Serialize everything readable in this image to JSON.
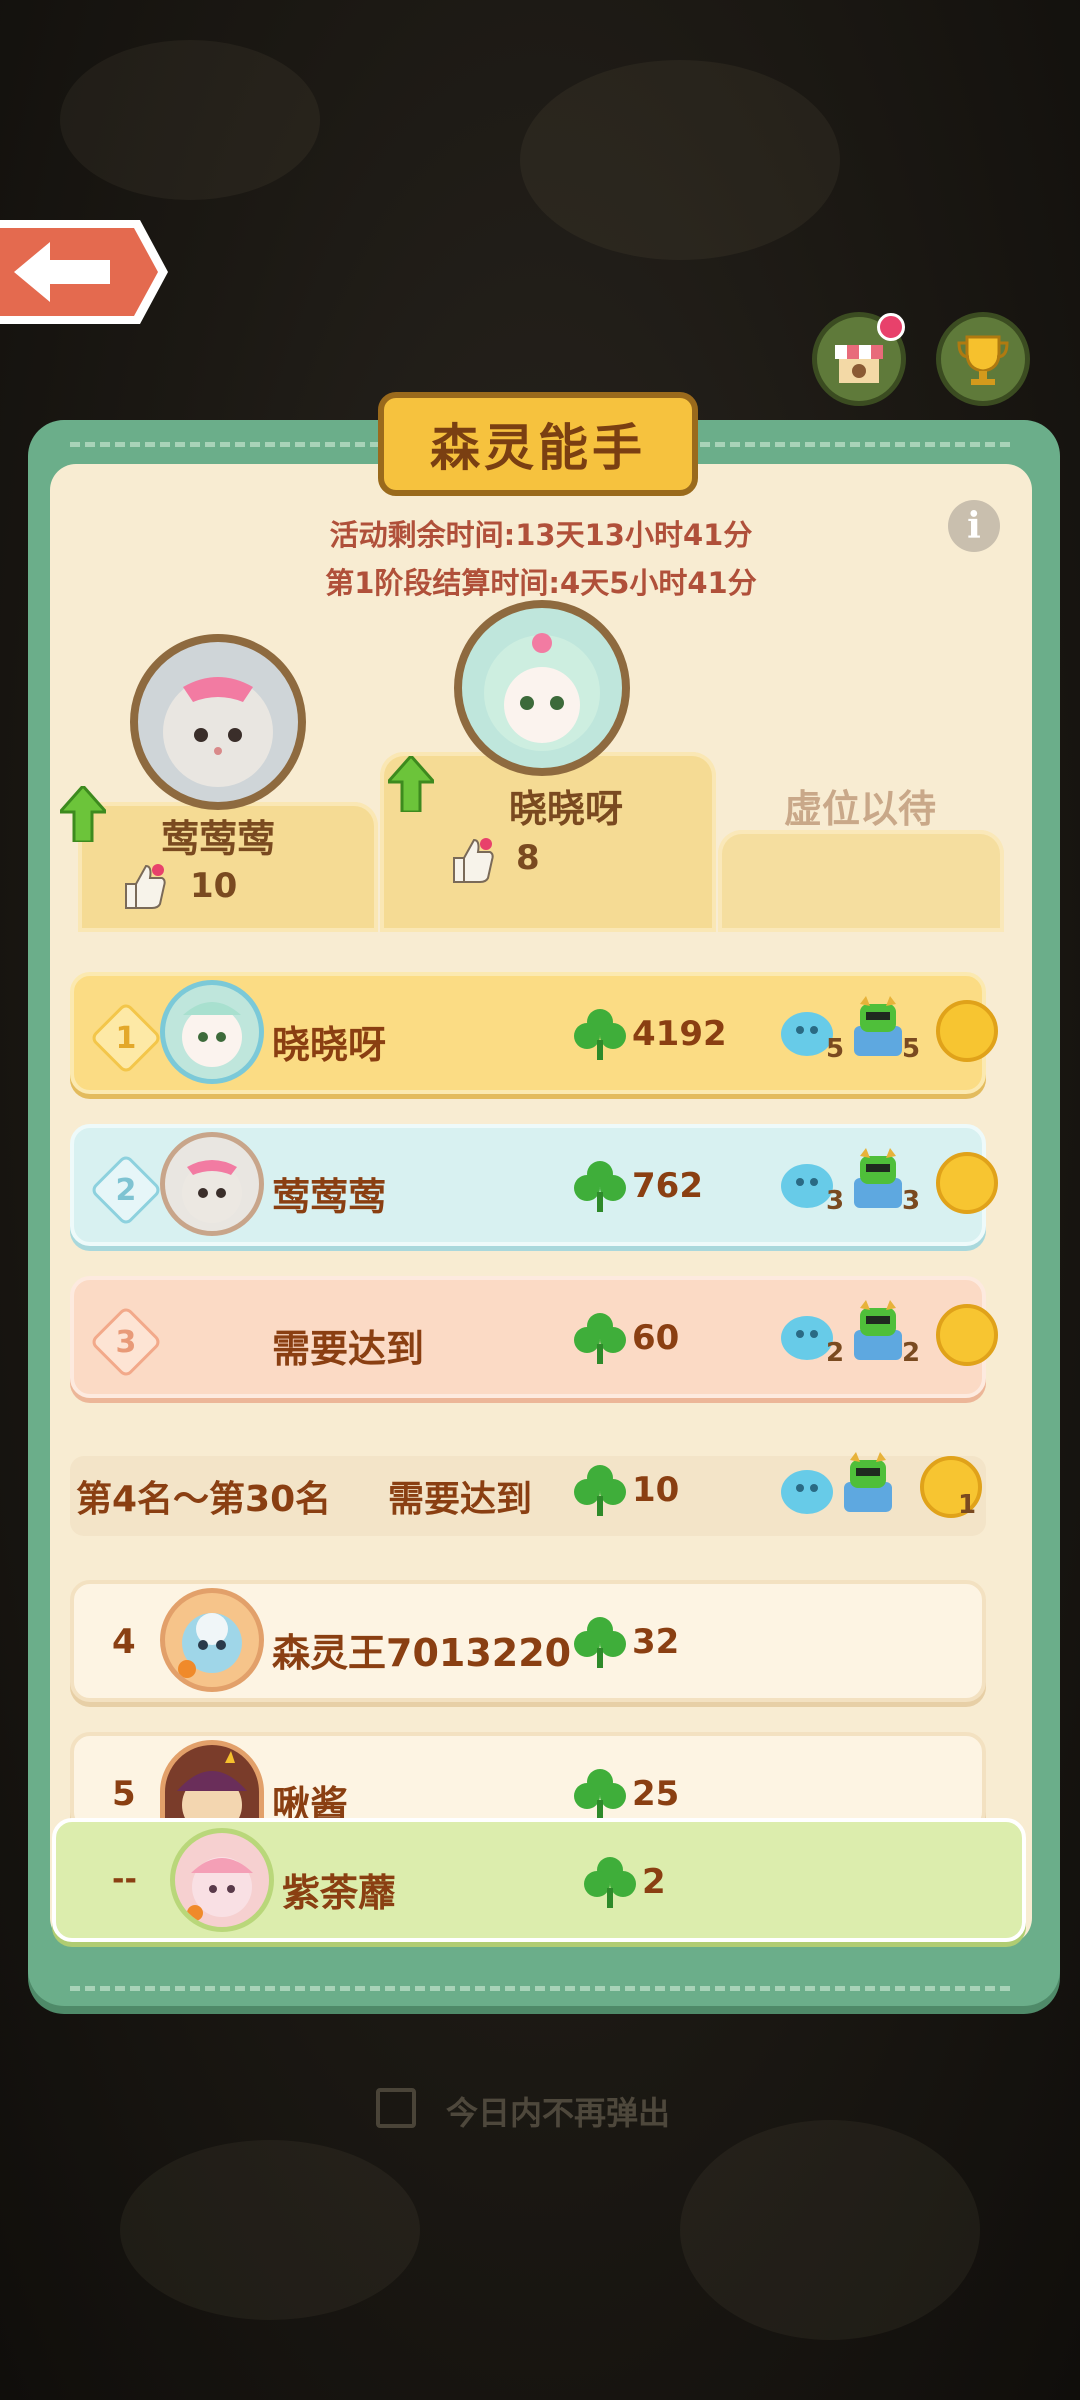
{
  "header": {
    "title": "森灵能手",
    "remaining_time": "活动剩余时间:13天13小时41分",
    "stage_settlement": "第1阶段结算时间:4天5小时41分"
  },
  "podium": [
    {
      "place": 2,
      "name": "莺莺莺",
      "likes": "10"
    },
    {
      "place": 1,
      "name": "晓晓呀",
      "likes": "8"
    },
    {
      "place": 3,
      "name": "虚位以待"
    }
  ],
  "top_rows": [
    {
      "rank": "1",
      "name": "晓晓呀",
      "score": "4192",
      "reward_a": "5",
      "reward_b": "5"
    },
    {
      "rank": "2",
      "name": "莺莺莺",
      "score": "762",
      "reward_a": "3",
      "reward_b": "3"
    },
    {
      "rank": "3",
      "name": "需要达到",
      "score": "60",
      "reward_a": "2",
      "reward_b": "2"
    }
  ],
  "tier_row": {
    "range": "第4名～第30名",
    "label": "需要达到",
    "score": "10",
    "coin": "1"
  },
  "list_rows": [
    {
      "rank": "4",
      "name": "森灵王7013220",
      "score": "32"
    },
    {
      "rank": "5",
      "name": "啾酱",
      "score": "25"
    }
  ],
  "self_row": {
    "rank": "--",
    "name": "紫荼蘼",
    "score": "2"
  },
  "footer": {
    "dont_show_today": "今日内不再弹出",
    "checked": false
  },
  "colors": {
    "panel_green": "#6bae8a",
    "panel_cream": "#f8ecd2",
    "text_brown": "#8a3f12",
    "clover_green": "#3fae3a"
  }
}
